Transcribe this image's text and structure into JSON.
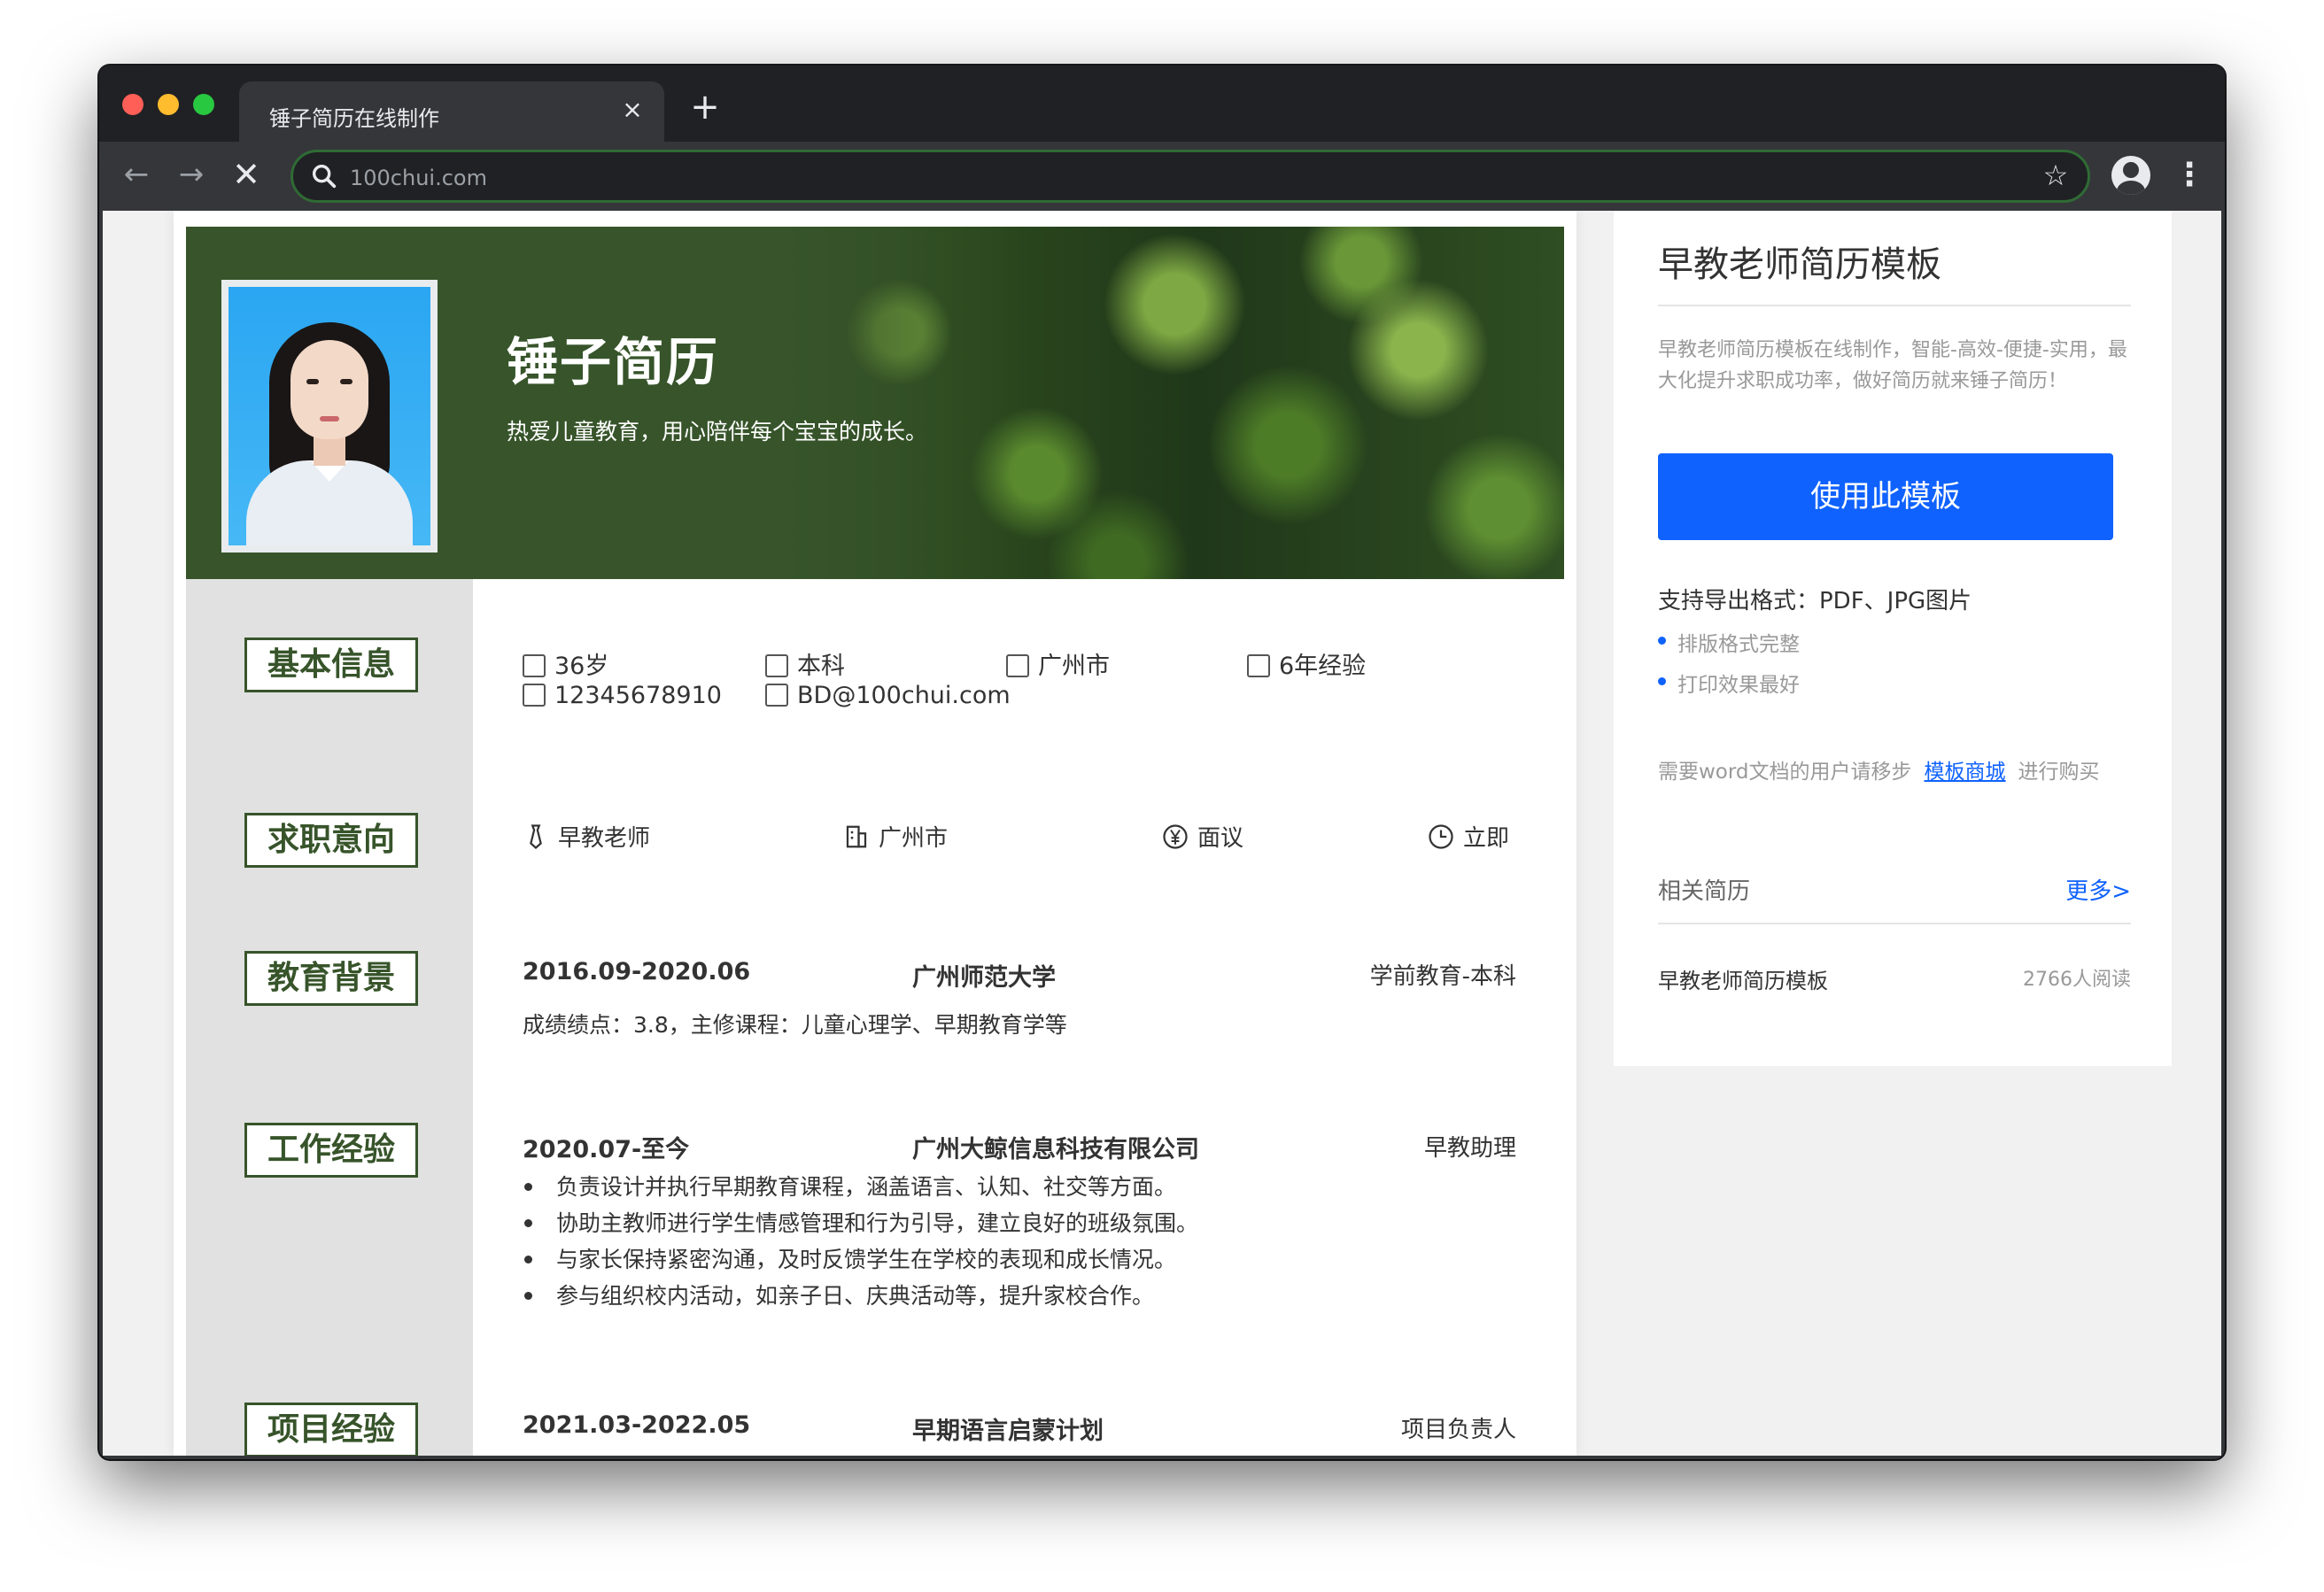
{
  "browser": {
    "tab_title": "锤子简历在线制作",
    "tab_close": "×",
    "new_tab": "+",
    "url": "100chui.com",
    "back": "←",
    "forward": "→",
    "stop": "✕",
    "star": "☆",
    "menu": "⋮"
  },
  "resume": {
    "name": "锤子简历",
    "motto": "热爱儿童教育，用心陪伴每个宝宝的成长。",
    "sections": {
      "basic": "基本信息",
      "intent": "求职意向",
      "education": "教育背景",
      "work": "工作经验",
      "project": "项目经验"
    },
    "basic_info": {
      "age": "36岁",
      "degree": "本科",
      "city": "广州市",
      "experience": "6年经验",
      "phone": "12345678910",
      "email": "BD@100chui.com"
    },
    "intent": {
      "position": "早教老师",
      "city": "广州市",
      "salary": "面议",
      "availability": "立即"
    },
    "education": {
      "date": "2016.09-2020.06",
      "school": "广州师范大学",
      "major": "学前教育-本科",
      "detail": "成绩绩点：3.8，主修课程：儿童心理学、早期教育学等"
    },
    "work": {
      "date": "2020.07-至今",
      "company": "广州大鲸信息科技有限公司",
      "role": "早教助理",
      "bullets": [
        "负责设计并执行早期教育课程，涵盖语言、认知、社交等方面。",
        "协助主教师进行学生情感管理和行为引导，建立良好的班级氛围。",
        "与家长保持紧密沟通，及时反馈学生在学校的表现和成长情况。",
        "参与组织校内活动，如亲子日、庆典活动等，提升家校合作。"
      ]
    },
    "project": {
      "date": "2021.03-2022.05",
      "name": "早期语言启蒙计划",
      "role": "项目负责人"
    }
  },
  "panel": {
    "title": "早教老师简历模板",
    "desc": "早教老师简历模板在线制作，智能-高效-便捷-实用，最大化提升求职成功率，做好简历就来锤子简历！",
    "use_button": "使用此模板",
    "export_label": "支持导出格式：PDF、JPG图片",
    "features": [
      "排版格式完整",
      "打印效果最好"
    ],
    "word_note_prefix": "需要word文档的用户请移步",
    "word_note_link": "模板商城",
    "word_note_suffix": "进行购买",
    "related_title": "相关简历",
    "related_more": "更多>",
    "related_item_name": "早教老师简历模板",
    "related_item_reads": "2766人阅读"
  },
  "colors": {
    "accent_green": "#37542a",
    "primary_blue": "#0f62fe"
  }
}
